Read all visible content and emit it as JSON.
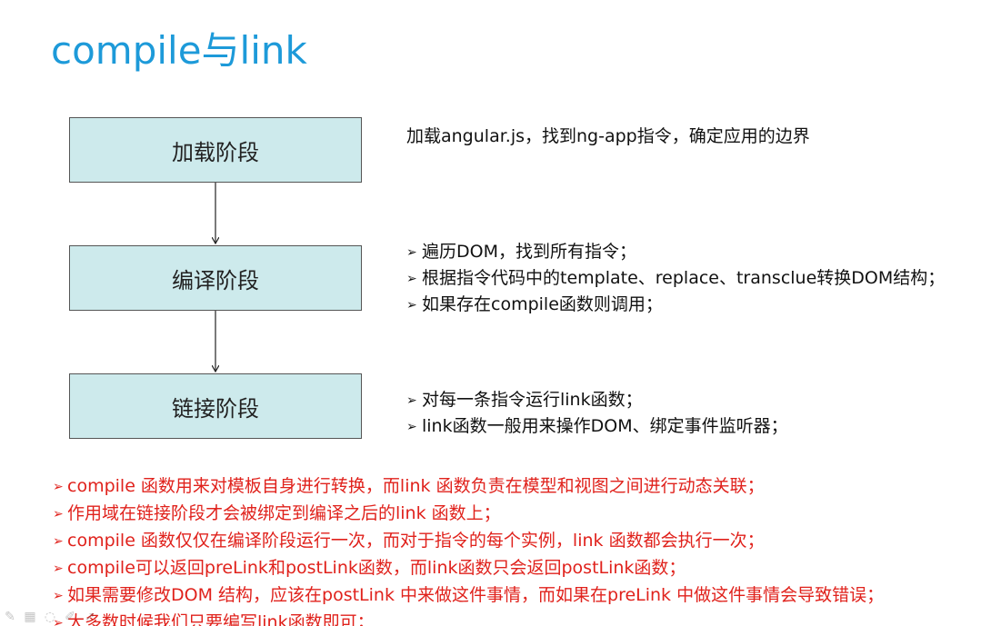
{
  "slide": {
    "title": "compile与link"
  },
  "stages": [
    {
      "label": "加载阶段"
    },
    {
      "label": "编译阶段"
    },
    {
      "label": "链接阶段"
    }
  ],
  "descriptions": {
    "load": {
      "text": "加载angular.js，找到ng-app指令，确定应用的边界"
    },
    "compile": {
      "lines": [
        "遍历DOM，找到所有指令；",
        "根据指令代码中的template、replace、transclue转换DOM结构；",
        "如果存在compile函数则调用；"
      ]
    },
    "link": {
      "lines": [
        "对每一条指令运行link函数；",
        "link函数一般用来操作DOM、绑定事件监听器；"
      ]
    }
  },
  "notes": [
    "compile 函数用来对模板自身进行转换，而link 函数负责在模型和视图之间进行动态关联；",
    "作用域在链接阶段才会被绑定到编译之后的link 函数上；",
    "compile 函数仅仅在编译阶段运行一次，而对于指令的每个实例，link 函数都会执行一次；",
    "compile可以返回preLink和postLink函数，而link函数只会返回postLink函数；",
    "如果需要修改DOM 结构，应该在postLink 中来做这件事情，而如果在preLink 中做这件事情会导致错误；",
    "大多数时候我们只要编写link函数即可；"
  ],
  "bullet_glyph": "➢",
  "colors": {
    "title": "#1d9ad9",
    "box_fill": "#cdeaec",
    "box_border": "#555555",
    "note_text": "#e0221c",
    "body_text": "#111111"
  },
  "toolbar_icons": [
    "pen-icon",
    "grid-icon",
    "highlighter-icon",
    "pencil-icon",
    "cursor-icon"
  ]
}
